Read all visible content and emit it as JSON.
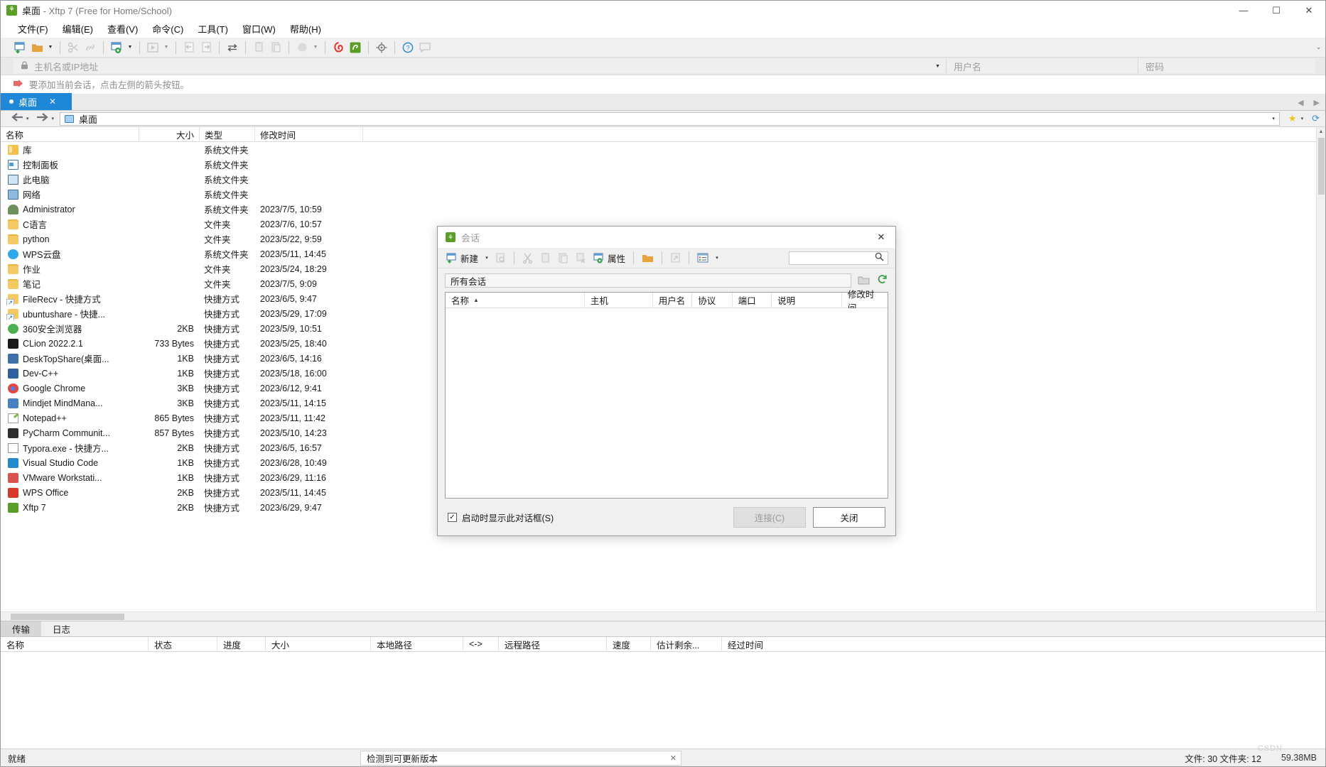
{
  "window": {
    "title_main": "桌面",
    "title_rest": " - Xftp 7 (Free for Home/School)",
    "minimize": "—",
    "maximize": "☐",
    "close": "✕"
  },
  "menubar": {
    "items": [
      {
        "label": "文件(F)",
        "name": "menu-file"
      },
      {
        "label": "编辑(E)",
        "name": "menu-edit"
      },
      {
        "label": "查看(V)",
        "name": "menu-view"
      },
      {
        "label": "命令(C)",
        "name": "menu-command"
      },
      {
        "label": "工具(T)",
        "name": "menu-tools"
      },
      {
        "label": "窗口(W)",
        "name": "menu-window"
      },
      {
        "label": "帮助(H)",
        "name": "menu-help"
      }
    ]
  },
  "toolbar": {
    "overflow": "⌄",
    "buttons": [
      {
        "icon": "new-session-icon",
        "glyph": "🗋"
      },
      {
        "icon": "open-folder-icon",
        "glyph": "📁"
      },
      {
        "icon": "disconnect-icon",
        "glyph": "✂"
      },
      {
        "icon": "link-icon",
        "glyph": "🔗"
      },
      {
        "icon": "properties-icon",
        "glyph": "⚙"
      },
      {
        "icon": "transfer-start-icon",
        "glyph": "▶"
      },
      {
        "icon": "download-icon",
        "glyph": "⬅"
      },
      {
        "icon": "upload-icon",
        "glyph": "➡"
      },
      {
        "icon": "sync-icon",
        "glyph": "⇄"
      },
      {
        "icon": "copy-icon",
        "glyph": "❏"
      },
      {
        "icon": "paste-icon",
        "glyph": "❐"
      },
      {
        "icon": "mode-icon",
        "glyph": "●"
      },
      {
        "icon": "xshell-icon",
        "glyph": "@"
      },
      {
        "icon": "xftp-icon",
        "glyph": "⚘"
      },
      {
        "icon": "settings-icon",
        "glyph": "⚙"
      },
      {
        "icon": "help-icon",
        "glyph": "?"
      },
      {
        "icon": "chat-icon",
        "glyph": "💬"
      }
    ]
  },
  "connbar": {
    "host_placeholder": "主机名或IP地址",
    "host_value": "",
    "user_placeholder": "用户名",
    "user_value": "",
    "pass_placeholder": "密码",
    "pass_value": "",
    "lock_icon": "🔒",
    "dropdown_icon": "▼"
  },
  "hint": {
    "arrow_icon": "➤",
    "text": "要添加当前会话，点击左侧的箭头按钮。"
  },
  "tabs": {
    "items": [
      {
        "label": "桌面",
        "close": "✕"
      }
    ],
    "nav_prev": "◀",
    "nav_next": "▶"
  },
  "pathbar": {
    "back": "⬅",
    "forward": "➡",
    "caret": "▾",
    "path": "桌面",
    "star_icon": "★",
    "star_caret": "▾",
    "refresh_icon": "⟳"
  },
  "filelist": {
    "columns": [
      "名称",
      "大小",
      "类型",
      "修改时间"
    ],
    "rows": [
      {
        "name": "库",
        "icon": "folder-library-icon",
        "cls": "ic-folder-lib",
        "size": "",
        "type": "系统文件夹",
        "mtime": ""
      },
      {
        "name": "控制面板",
        "icon": "control-panel-icon",
        "cls": "ic-cpanel",
        "size": "",
        "type": "系统文件夹",
        "mtime": ""
      },
      {
        "name": "此电脑",
        "icon": "this-pc-icon",
        "cls": "ic-pc",
        "size": "",
        "type": "系统文件夹",
        "mtime": ""
      },
      {
        "name": "网络",
        "icon": "network-icon",
        "cls": "ic-net",
        "size": "",
        "type": "系统文件夹",
        "mtime": ""
      },
      {
        "name": "Administrator",
        "icon": "user-icon",
        "cls": "ic-user",
        "size": "",
        "type": "系统文件夹",
        "mtime": "2023/7/5, 10:59"
      },
      {
        "name": "C语言",
        "icon": "folder-icon",
        "cls": "ic-folder",
        "size": "",
        "type": "文件夹",
        "mtime": "2023/7/6, 10:57"
      },
      {
        "name": "python",
        "icon": "folder-icon",
        "cls": "ic-folder",
        "size": "",
        "type": "文件夹",
        "mtime": "2023/5/22, 9:59"
      },
      {
        "name": "WPS云盘",
        "icon": "wps-cloud-icon",
        "cls": "ic-cloud",
        "size": "",
        "type": "系统文件夹",
        "mtime": "2023/5/11, 14:45"
      },
      {
        "name": "作业",
        "icon": "folder-icon",
        "cls": "ic-folder",
        "size": "",
        "type": "文件夹",
        "mtime": "2023/5/24, 18:29"
      },
      {
        "name": "笔记",
        "icon": "folder-icon",
        "cls": "ic-folder",
        "size": "",
        "type": "文件夹",
        "mtime": "2023/7/5, 9:09"
      },
      {
        "name": "FileRecv - 快捷方式",
        "icon": "shortcut-icon",
        "cls": "ic-shortcut",
        "size": "",
        "type": "快捷方式",
        "mtime": "2023/6/5, 9:47"
      },
      {
        "name": "ubuntushare - 快捷...",
        "icon": "shortcut-icon",
        "cls": "ic-shortcut",
        "size": "",
        "type": "快捷方式",
        "mtime": "2023/5/29, 17:09"
      },
      {
        "name": "360安全浏览器",
        "icon": "browser-360-icon",
        "cls": "ic-360",
        "size": "2KB",
        "type": "快捷方式",
        "mtime": "2023/5/9, 10:51"
      },
      {
        "name": "CLion 2022.2.1",
        "icon": "clion-icon",
        "cls": "ic-clion",
        "size": "733 Bytes",
        "type": "快捷方式",
        "mtime": "2023/5/25, 18:40"
      },
      {
        "name": "DeskTopShare(桌面...",
        "icon": "desktopshare-icon",
        "cls": "ic-dts",
        "size": "1KB",
        "type": "快捷方式",
        "mtime": "2023/6/5, 14:16"
      },
      {
        "name": "Dev-C++",
        "icon": "devcpp-icon",
        "cls": "ic-dev",
        "size": "1KB",
        "type": "快捷方式",
        "mtime": "2023/5/18, 16:00"
      },
      {
        "name": "Google Chrome",
        "icon": "chrome-icon",
        "cls": "ic-chrome",
        "size": "3KB",
        "type": "快捷方式",
        "mtime": "2023/6/12, 9:41"
      },
      {
        "name": "Mindjet MindMana...",
        "icon": "mindjet-icon",
        "cls": "ic-mindjet",
        "size": "3KB",
        "type": "快捷方式",
        "mtime": "2023/5/11, 14:15"
      },
      {
        "name": "Notepad++",
        "icon": "notepadpp-icon",
        "cls": "ic-npp",
        "size": "865 Bytes",
        "type": "快捷方式",
        "mtime": "2023/5/11, 11:42"
      },
      {
        "name": "PyCharm Communit...",
        "icon": "pycharm-icon",
        "cls": "ic-pycharm",
        "size": "857 Bytes",
        "type": "快捷方式",
        "mtime": "2023/5/10, 14:23"
      },
      {
        "name": "Typora.exe - 快捷方...",
        "icon": "typora-icon",
        "cls": "ic-typora",
        "size": "2KB",
        "type": "快捷方式",
        "mtime": "2023/6/5, 16:57"
      },
      {
        "name": "Visual Studio Code",
        "icon": "vscode-icon",
        "cls": "ic-vscode",
        "size": "1KB",
        "type": "快捷方式",
        "mtime": "2023/6/28, 10:49"
      },
      {
        "name": "VMware Workstati...",
        "icon": "vmware-icon",
        "cls": "ic-vmware",
        "size": "1KB",
        "type": "快捷方式",
        "mtime": "2023/6/29, 11:16"
      },
      {
        "name": "WPS Office",
        "icon": "wps-office-icon",
        "cls": "ic-wps",
        "size": "2KB",
        "type": "快捷方式",
        "mtime": "2023/5/11, 14:45"
      },
      {
        "name": "Xftp 7",
        "icon": "xftp-icon",
        "cls": "ic-xftp",
        "size": "2KB",
        "type": "快捷方式",
        "mtime": "2023/6/29, 9:47"
      }
    ]
  },
  "transfer": {
    "tabs": [
      {
        "label": "传输",
        "active": true
      },
      {
        "label": "日志",
        "active": false
      }
    ],
    "columns": [
      "名称",
      "状态",
      "进度",
      "大小",
      "本地路径",
      "<->",
      "远程路径",
      "速度",
      "估计剩余...",
      "经过时间"
    ]
  },
  "statusbar": {
    "ready": "就绪",
    "update_text": "检测到可更新版本",
    "update_close": "✕",
    "counts": "文件: 30 文件夹: 12",
    "memory": "59.38MB",
    "watermark": "CSDN"
  },
  "dialog": {
    "title": "会话",
    "close": "✕",
    "toolbar": {
      "new_label": "新建",
      "new_caret": "▾",
      "properties_label": "属性",
      "icons": [
        {
          "name": "new-session-icon",
          "glyph": "🗋"
        },
        {
          "name": "find-icon",
          "glyph": "🔍"
        },
        {
          "name": "cut-icon",
          "glyph": "✂"
        },
        {
          "name": "copy-icon",
          "glyph": "❏"
        },
        {
          "name": "paste-icon",
          "glyph": "❐"
        },
        {
          "name": "delete-icon",
          "glyph": "🗑"
        },
        {
          "name": "properties-icon",
          "glyph": "⚙"
        },
        {
          "name": "open-folder-icon",
          "glyph": "📁"
        },
        {
          "name": "shortcut-icon",
          "glyph": "↗"
        },
        {
          "name": "view-icon",
          "glyph": "▤"
        },
        {
          "name": "view-caret-icon",
          "glyph": "▾"
        }
      ],
      "search_value": "",
      "search_icon": "🔍"
    },
    "filter": {
      "value": "所有会话",
      "folder_icon": "🗀",
      "refresh_icon": "⟳"
    },
    "list": {
      "columns": [
        "名称",
        "主机",
        "用户名",
        "协议",
        "端口",
        "说明",
        "修改时间"
      ],
      "sort_indicator": "▲",
      "rows": []
    },
    "footer": {
      "checkbox_label": "启动时显示此对话框(S)",
      "checkbox_checked": true,
      "checkbox_mark": "✓",
      "connect_label": "连接(C)",
      "close_label": "关闭"
    }
  }
}
